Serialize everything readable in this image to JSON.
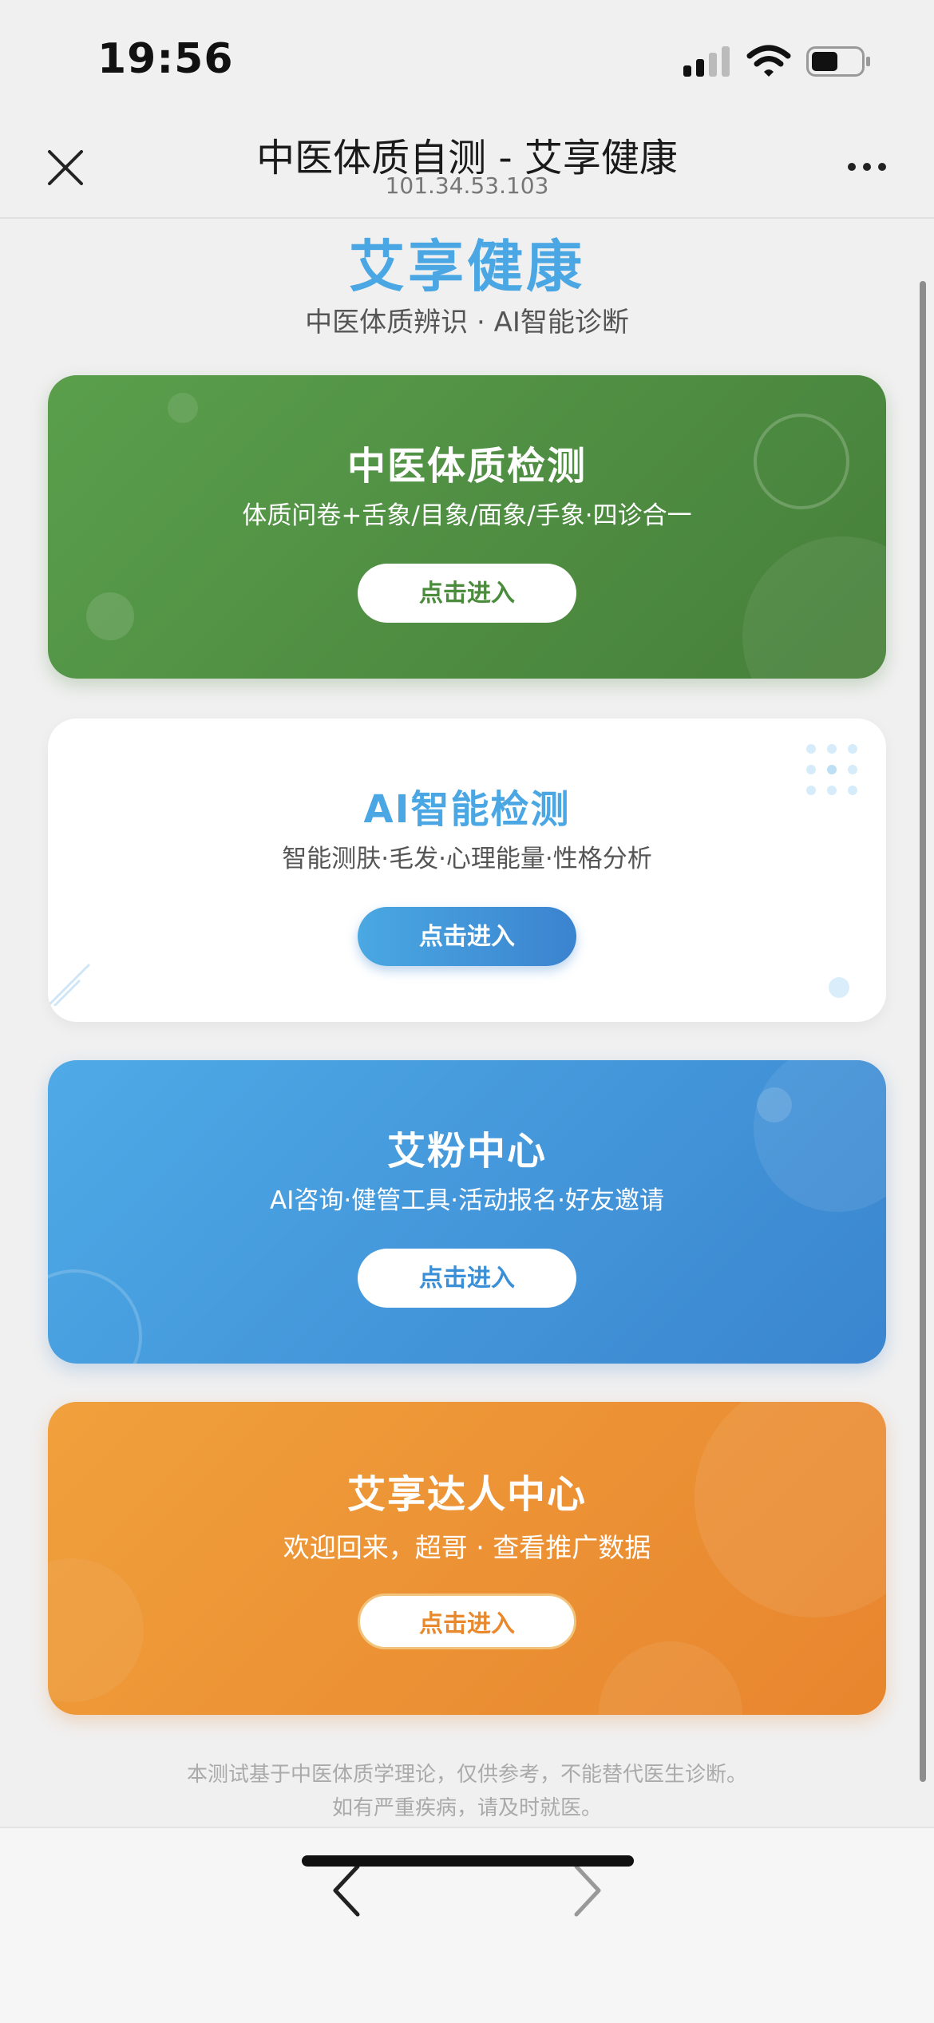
{
  "status_bar": {
    "time": "19:56"
  },
  "header": {
    "title": "中医体质自测 - 艾享健康",
    "subtitle": "101.34.53.103"
  },
  "brand": {
    "title": "艾享健康",
    "subtitle": "中医体质辨识 · AI智能诊断"
  },
  "cards": [
    {
      "title": "中医体质检测",
      "desc": "体质问卷+舌象/目象/面象/手象·四诊合一",
      "button": "点击进入",
      "color": "#4e8f41"
    },
    {
      "title": "AI智能检测",
      "desc": "智能测肤·毛发·心理能量·性格分析",
      "button": "点击进入",
      "color": "#4ba7e3"
    },
    {
      "title": "艾粉中心",
      "desc": "AI咨询·健管工具·活动报名·好友邀请",
      "button": "点击进入",
      "color": "#3f95da"
    },
    {
      "title": "艾享达人中心",
      "desc": "欢迎回来，超哥 · 查看推广数据",
      "button": "点击进入",
      "color": "#ec9233"
    }
  ],
  "disclaimer": {
    "line1": "本测试基于中医体质学理论，仅供参考，不能替代医生诊断。",
    "line2": "如有严重疾病，请及时就医。"
  },
  "icons": {
    "close": "close-icon",
    "more": "more-icon",
    "back": "chevron-left-icon",
    "forward": "chevron-right-icon"
  }
}
